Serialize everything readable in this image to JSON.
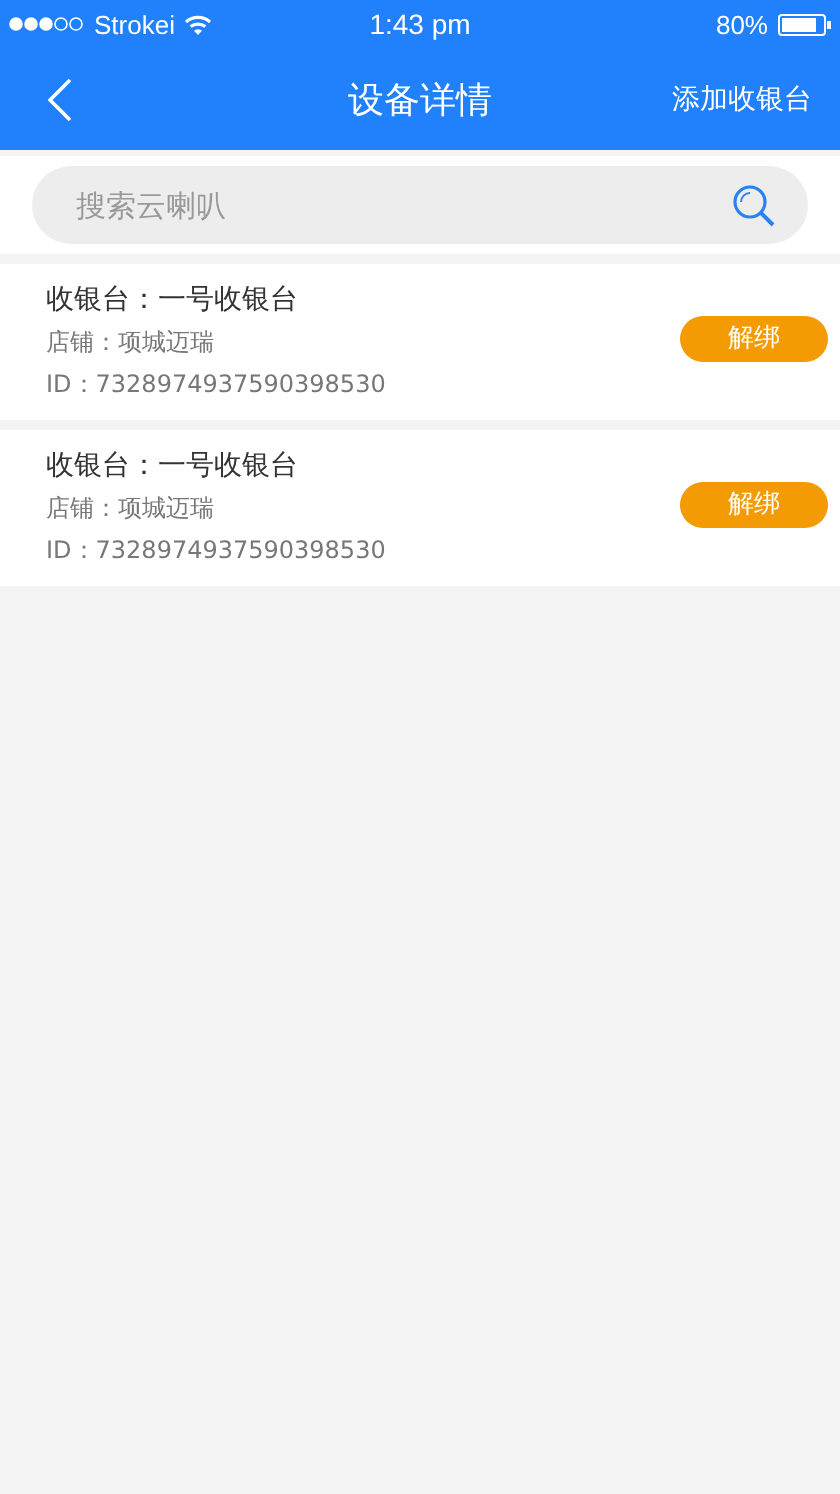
{
  "status_bar": {
    "carrier": "Strokei",
    "time": "1:43 pm",
    "battery": "80%"
  },
  "header": {
    "title": "设备详情",
    "action": "添加收银台"
  },
  "search": {
    "placeholder": "搜索云喇叭"
  },
  "devices": [
    {
      "name": "收银台：一号收银台",
      "store": "店铺：项城迈瑞",
      "id": "ID：7328974937590398530",
      "button": "解绑"
    },
    {
      "name": "收银台：一号收银台",
      "store": "店铺：项城迈瑞",
      "id": "ID：7328974937590398530",
      "button": "解绑"
    }
  ]
}
